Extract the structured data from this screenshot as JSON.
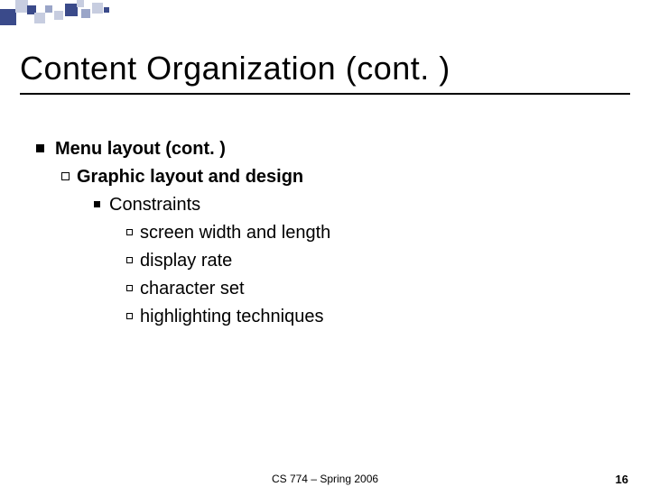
{
  "title": "Content Organization (cont. )",
  "l1": "Menu layout (cont. )",
  "l2": "Graphic layout and design",
  "l3": "Constraints",
  "l4a": "screen width and length",
  "l4b": "display rate",
  "l4c": "character set",
  "l4d": "highlighting techniques",
  "footer_center": "CS 774 – Spring 2006",
  "footer_right": "16"
}
